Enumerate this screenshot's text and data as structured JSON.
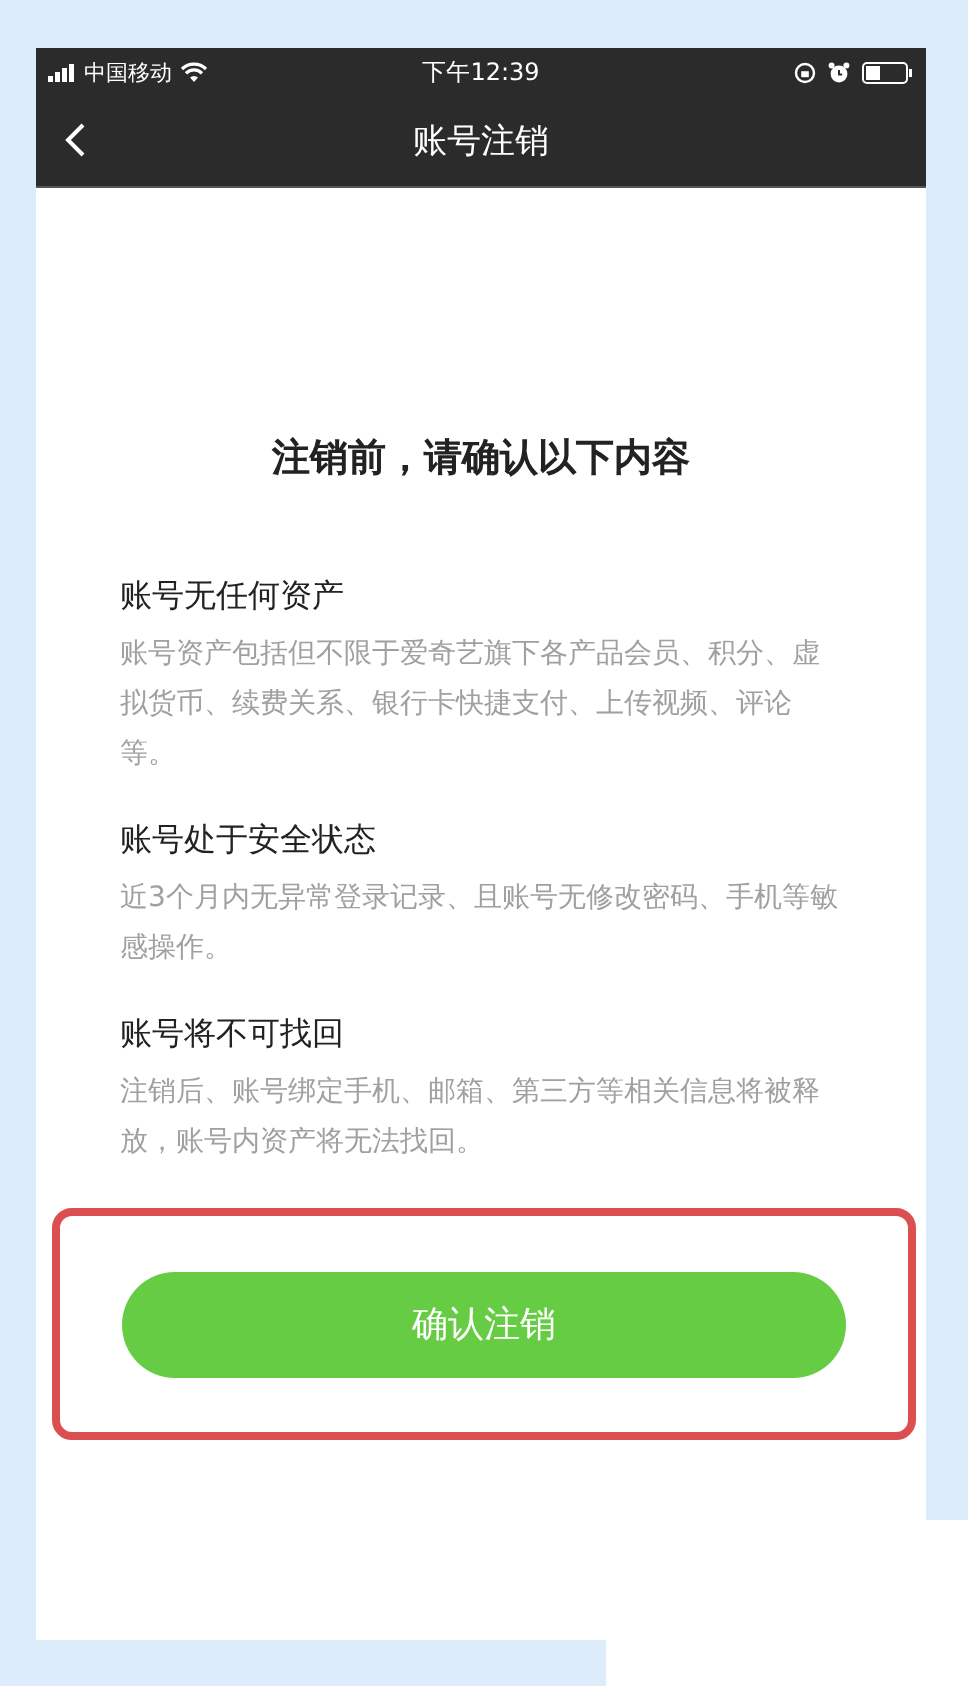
{
  "status_bar": {
    "carrier": "中国移动",
    "time": "下午12:39"
  },
  "nav": {
    "title": "账号注销"
  },
  "heading": "注销前，请确认以下内容",
  "sections": [
    {
      "title": "账号无任何资产",
      "description": "账号资产包括但不限于爱奇艺旗下各产品会员、积分、虚拟货币、续费关系、银行卡快捷支付、上传视频、评论等。"
    },
    {
      "title": "账号处于安全状态",
      "description": "近3个月内无异常登录记录、且账号无修改密码、手机等敏感操作。"
    },
    {
      "title": "账号将不可找回",
      "description": "注销后、账号绑定手机、邮箱、第三方等相关信息将被释放，账号内资产将无法找回。"
    }
  ],
  "confirm_button": {
    "label": "确认注销"
  }
}
